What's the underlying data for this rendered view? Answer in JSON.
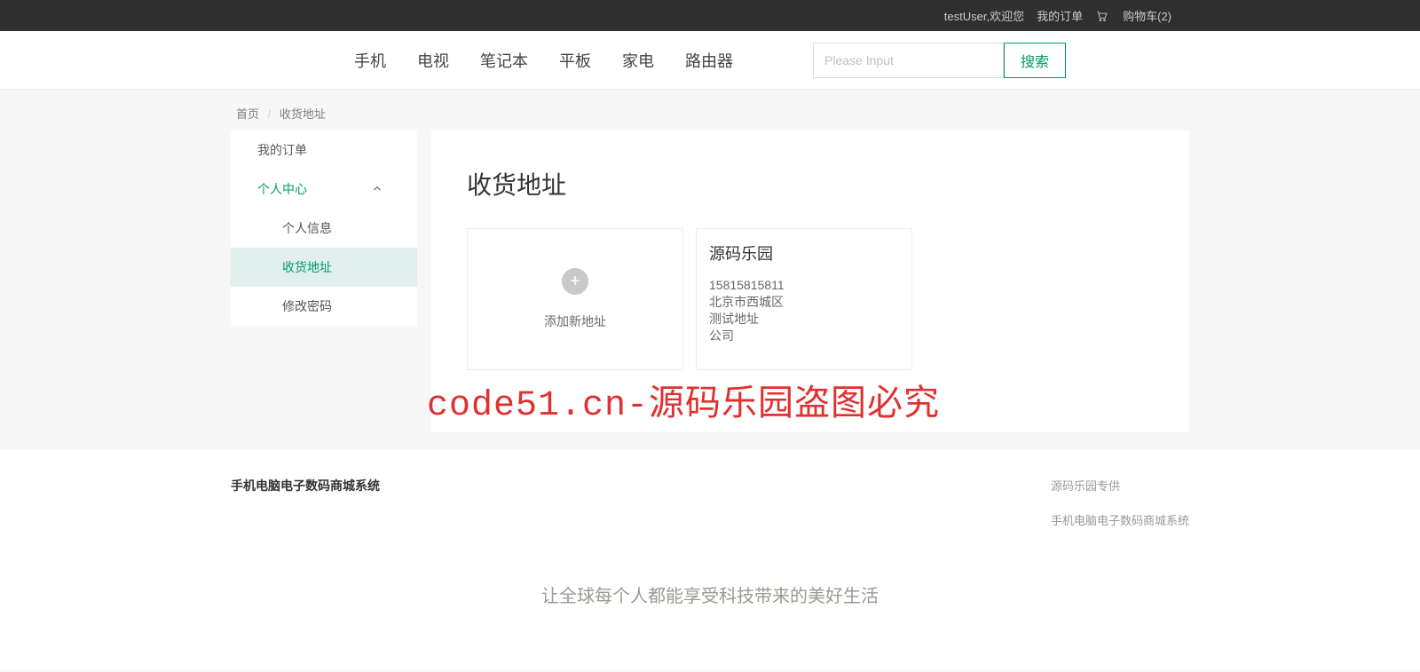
{
  "topbar": {
    "welcome": "testUser,欢迎您",
    "orders": "我的订单",
    "cart": "购物车(2)"
  },
  "nav": {
    "items": [
      "手机",
      "电视",
      "笔记本",
      "平板",
      "家电",
      "路由器"
    ]
  },
  "search": {
    "placeholder": "Please Input",
    "button": "搜索"
  },
  "crumb": {
    "home": "首页",
    "current": "收货地址"
  },
  "side": {
    "orders": "我的订单",
    "center": "个人中心",
    "info": "个人信息",
    "addr": "收货地址",
    "pwd": "修改密码"
  },
  "page": {
    "title": "收货地址",
    "add_label": "添加新地址"
  },
  "address": {
    "name": "源码乐园",
    "phone": "15815815811",
    "region": "北京市西城区",
    "detail": "测试地址",
    "tag": "公司"
  },
  "watermark": "code51.cn-源码乐园盗图必究",
  "footer": {
    "title": "手机电脑电子数码商城系统",
    "line1": "源码乐园专供",
    "line2": "手机电脑电子数码商城系统",
    "slogan": "让全球每个人都能享受科技带来的美好生活"
  }
}
